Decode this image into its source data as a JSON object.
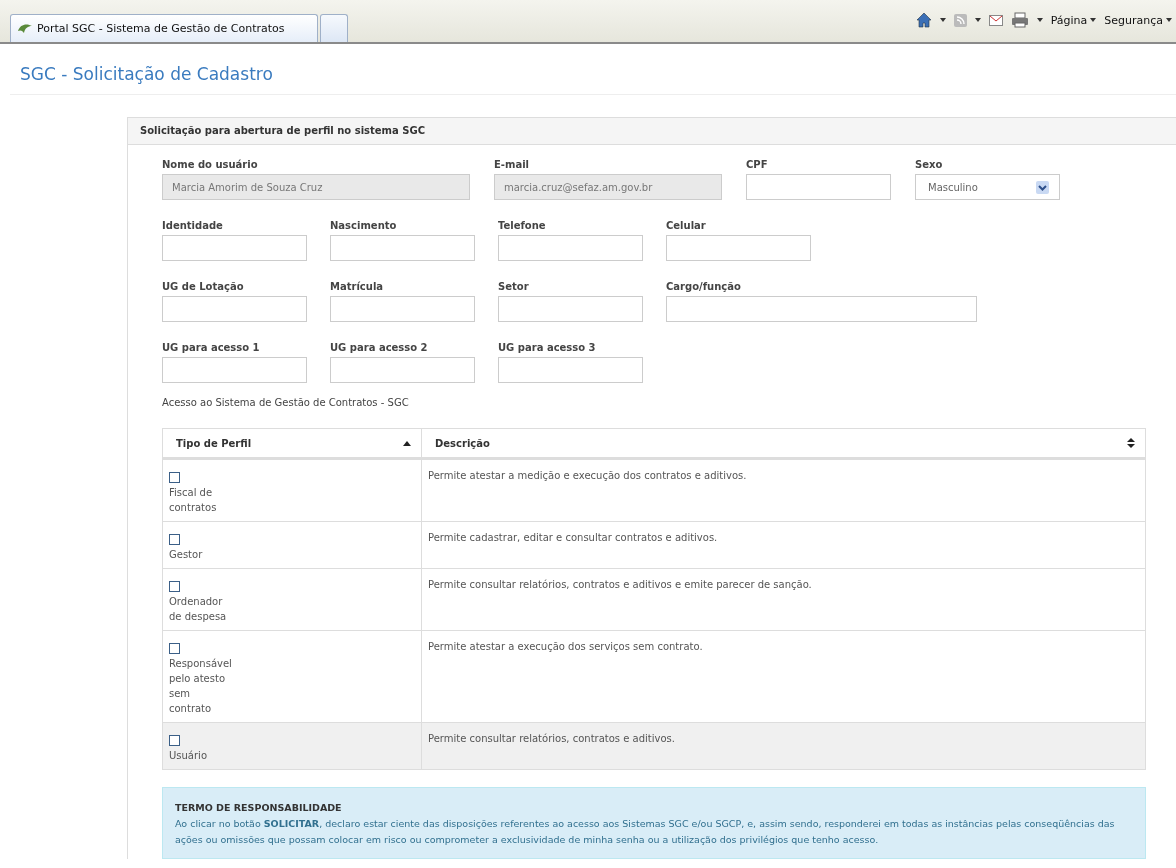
{
  "browser": {
    "tabs": [
      {
        "title": "Portal SGC - Sistema de Gestão de Contratos",
        "selected": true
      },
      {
        "selected": false
      }
    ],
    "menus": [
      "Página",
      "Segurança"
    ]
  },
  "page_title": "SGC - Solicitação de Cadastro",
  "panel": {
    "title": "Solicitação para abertura de perfil no sistema SGC",
    "field_rows": [
      [
        {
          "label": "Nome do usuário",
          "kind": "text",
          "value": "Marcia Amorim de Souza Cruz",
          "disabled": true
        },
        {
          "label": "E-mail",
          "kind": "text",
          "value": "marcia.cruz@sefaz.am.gov.br",
          "disabled": true
        },
        {
          "label": "CPF",
          "kind": "text",
          "disabled": false
        },
        {
          "label": "Sexo",
          "kind": "select",
          "value": "Masculino",
          "disabled": false
        }
      ],
      [
        {
          "label": "Identidade",
          "kind": "text",
          "disabled": false
        },
        {
          "label": "Nascimento",
          "kind": "text",
          "disabled": false
        },
        {
          "label": "Telefone",
          "kind": "text",
          "disabled": false
        },
        {
          "label": "Celular",
          "kind": "text",
          "disabled": false
        }
      ],
      [
        {
          "label": "UG de Lotação",
          "kind": "text",
          "disabled": false
        },
        {
          "label": "Matrícula",
          "kind": "text",
          "disabled": false
        },
        {
          "label": "Setor",
          "kind": "text",
          "disabled": false
        },
        {
          "label": "Cargo/função",
          "kind": "text",
          "disabled": false
        }
      ],
      [
        {
          "label": "UG para acesso 1",
          "kind": "text",
          "disabled": false
        },
        {
          "label": "UG para acesso 2",
          "kind": "text",
          "disabled": false
        },
        {
          "label": "UG para acesso 3",
          "kind": "text",
          "disabled": false
        }
      ]
    ],
    "section_label": "Acesso ao Sistema de Gestão de Contratos - SGC",
    "table": {
      "columns": [
        {
          "label": "Tipo de Perfil",
          "sorted": true
        },
        {
          "label": "Descrição",
          "sorted": false
        }
      ],
      "rows": [
        {
          "profile": "Fiscal de contratos",
          "checked": false,
          "highlighted": false,
          "description": "Permite atestar a medição e execução dos contratos e aditivos."
        },
        {
          "profile": "Gestor",
          "checked": false,
          "highlighted": false,
          "description": "Permite cadastrar, editar e consultar contratos e aditivos."
        },
        {
          "profile": "Ordenador de despesa",
          "checked": false,
          "highlighted": false,
          "description": "Permite consultar relatórios, contratos e aditivos e emite parecer de sanção."
        },
        {
          "profile": "Responsável pelo atesto sem contrato",
          "checked": false,
          "highlighted": false,
          "description": "Permite atestar a execução dos serviços sem contrato."
        },
        {
          "profile": "Usuário",
          "checked": false,
          "highlighted": true,
          "description": "Permite consultar relatórios, contratos e aditivos."
        }
      ]
    },
    "notice": {
      "title": "TERMO DE RESPONSABILIDADE",
      "text": "Ao clicar no botão **SOLICITAR**, declaro estar ciente das disposições referentes ao acesso aos Sistemas SGC e/ou SGCP, e, assim sendo, responderei em todas as instâncias pelas conseqüências das ações ou omissões que possam colocar em risco ou comprometer a exclusividade de minha senha ou a utilização dos privilégios que tenho acesso."
    }
  }
}
